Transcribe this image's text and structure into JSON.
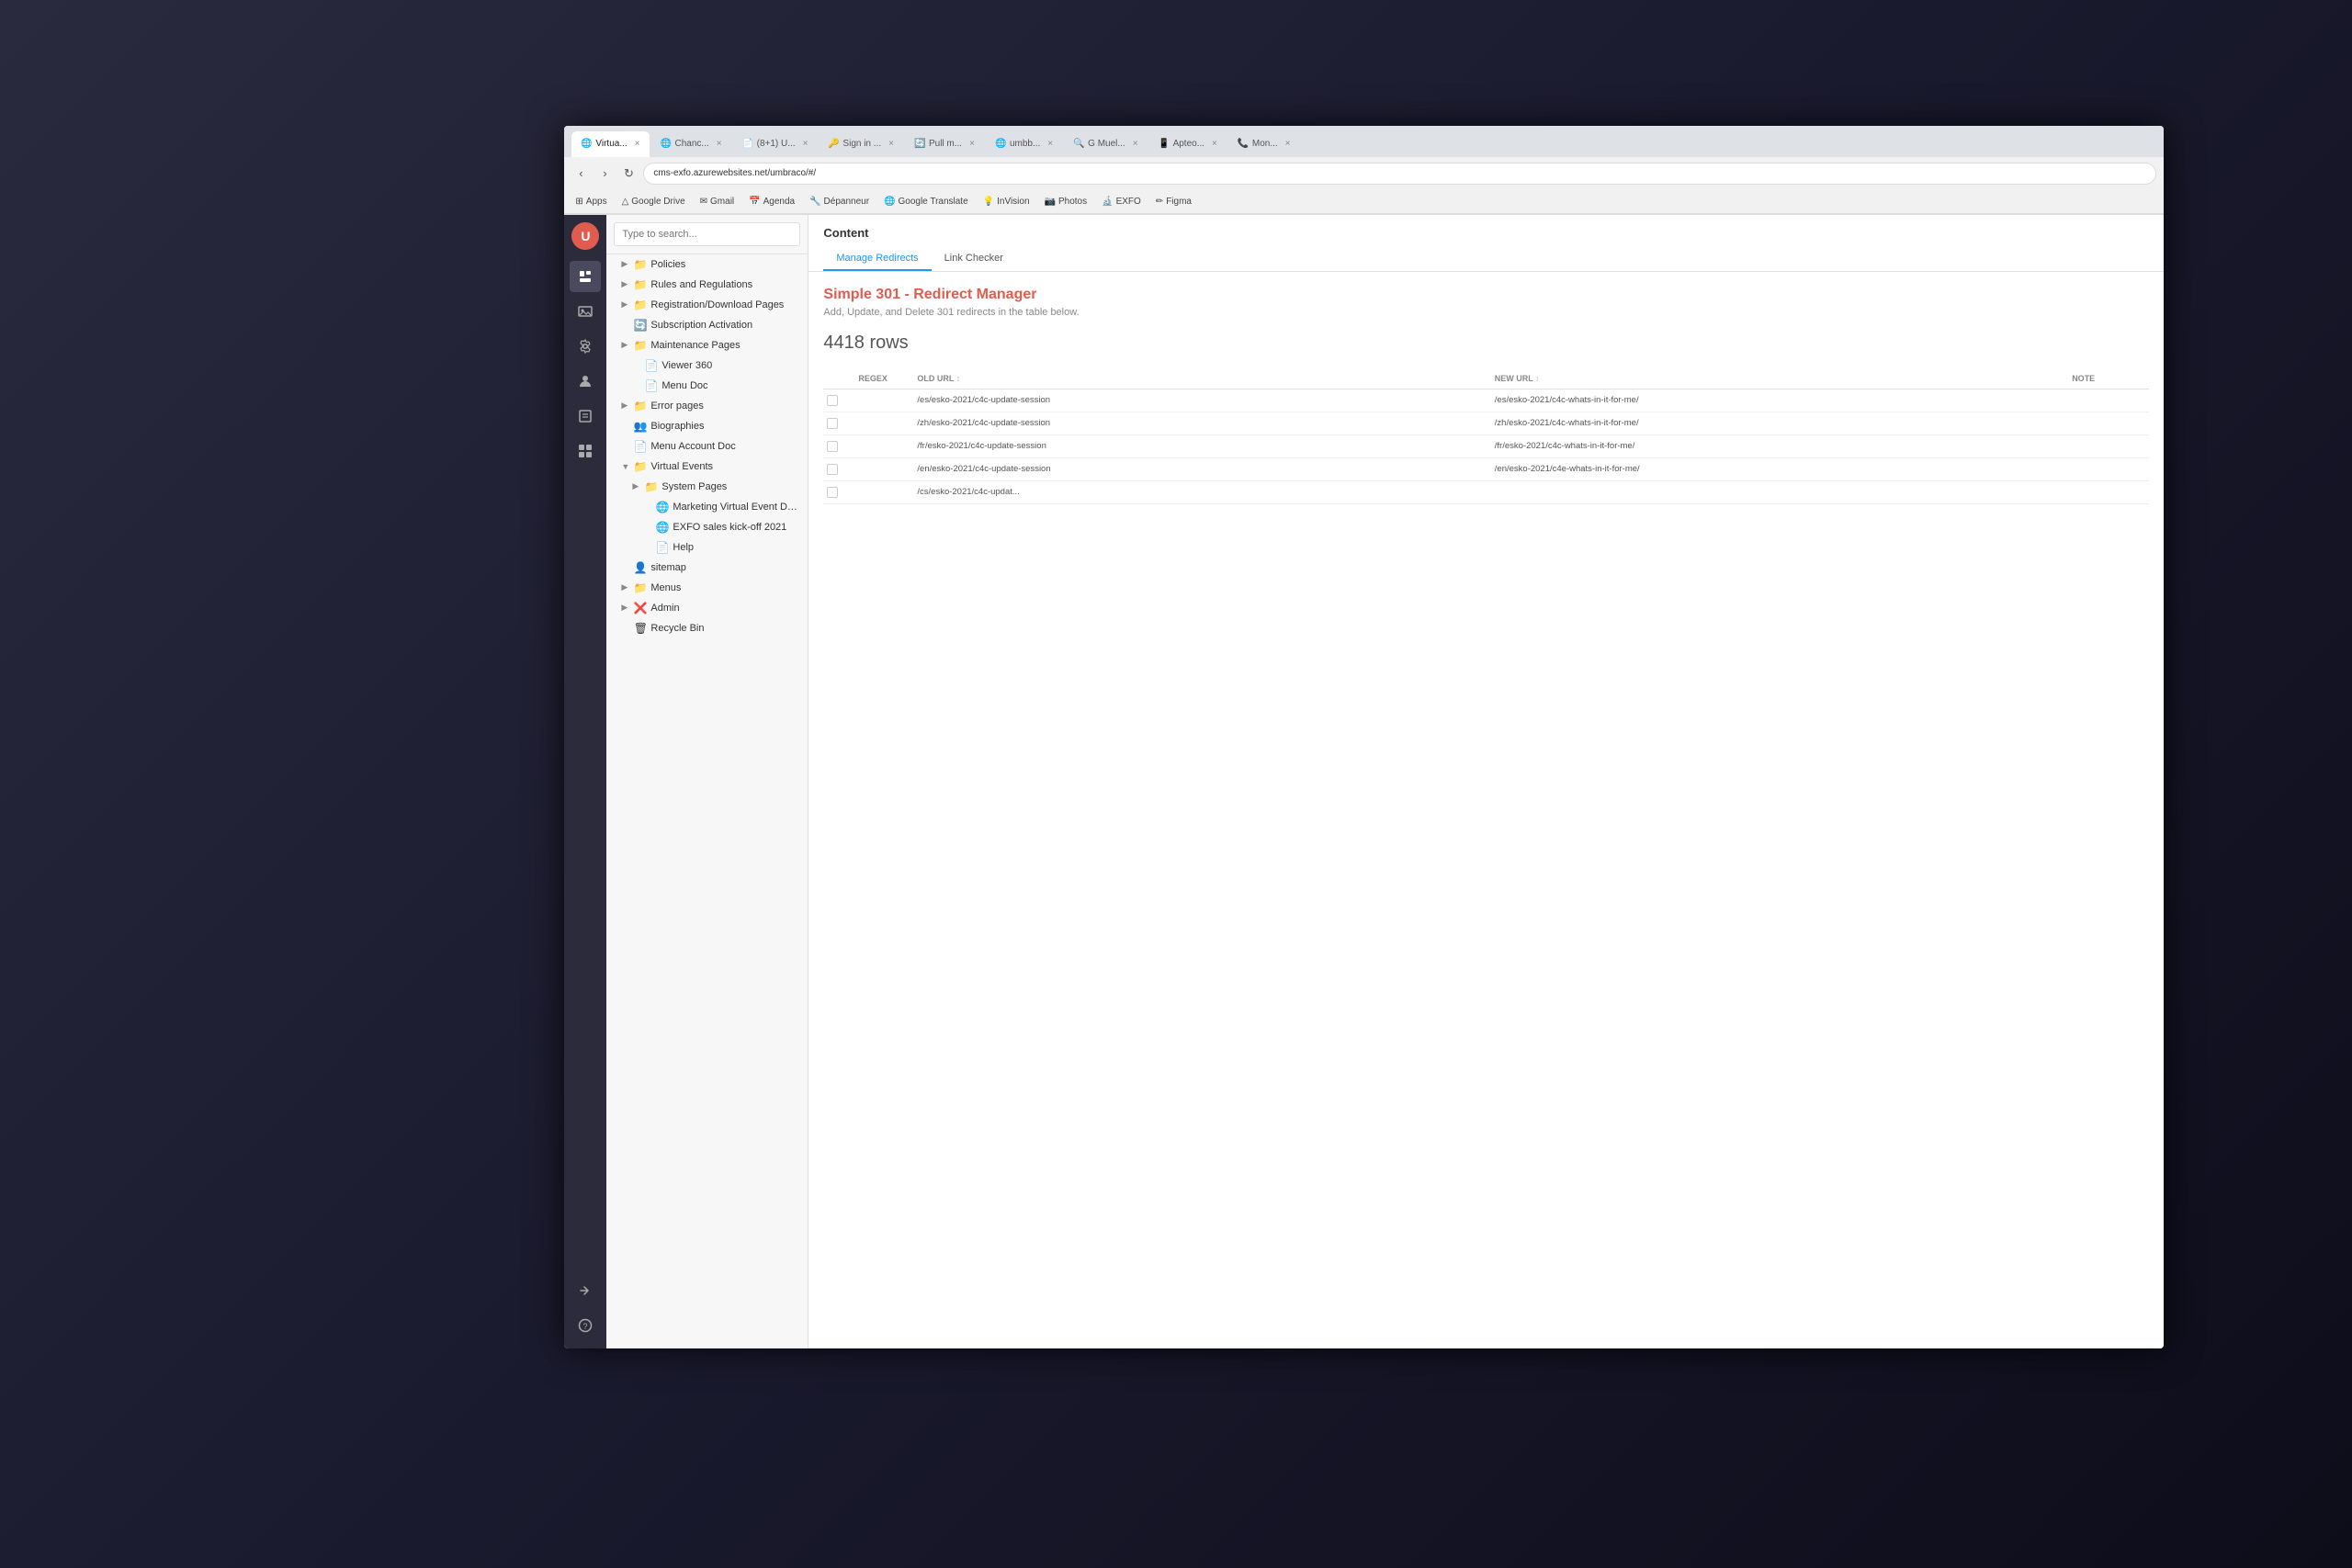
{
  "browser": {
    "address": "cms-exfo.azurewebsites.net/umbraco/#/",
    "tabs": [
      {
        "label": "Chanc...",
        "active": false,
        "favicon": "🌐"
      },
      {
        "label": "(8+1) U...",
        "active": false,
        "favicon": "📄"
      },
      {
        "label": "Sign in ...",
        "active": false,
        "favicon": "🔑"
      },
      {
        "label": "Pull m...",
        "active": false,
        "favicon": "🔄"
      },
      {
        "label": "Virtua...",
        "active": true,
        "favicon": "🌐"
      },
      {
        "label": "umbb...",
        "active": false,
        "favicon": "🌐"
      },
      {
        "label": "G Muel...",
        "active": false,
        "favicon": "🔍"
      },
      {
        "label": "Apteo...",
        "active": false,
        "favicon": "📱"
      },
      {
        "label": "Mon...",
        "active": false,
        "favicon": "📞"
      }
    ],
    "bookmarks": [
      {
        "label": "Apps",
        "favicon": "⊞"
      },
      {
        "label": "Google Drive",
        "favicon": "△"
      },
      {
        "label": "Gmail",
        "favicon": "✉"
      },
      {
        "label": "Agenda",
        "favicon": "📅"
      },
      {
        "label": "Dépanneur",
        "favicon": "🔧"
      },
      {
        "label": "Google Translate",
        "favicon": "🌐"
      },
      {
        "label": "InVision",
        "favicon": "💡"
      },
      {
        "label": "Photos",
        "favicon": "📷"
      },
      {
        "label": "EXFO",
        "favicon": "🔬"
      },
      {
        "label": "Figma",
        "favicon": "✏"
      }
    ]
  },
  "sidebar": {
    "icons": [
      {
        "name": "content",
        "icon": "📄"
      },
      {
        "name": "media",
        "icon": "🖼"
      },
      {
        "name": "settings",
        "icon": "⚙"
      },
      {
        "name": "users",
        "icon": "👤"
      },
      {
        "name": "forms",
        "icon": "📋"
      },
      {
        "name": "dashboard",
        "icon": "▦"
      },
      {
        "name": "redirect",
        "icon": "➤"
      },
      {
        "name": "help",
        "icon": "?"
      }
    ]
  },
  "search": {
    "placeholder": "Type to search..."
  },
  "tree": {
    "items": [
      {
        "label": "Policies",
        "level": 1,
        "icon": "📁",
        "hasChildren": true,
        "expanded": false
      },
      {
        "label": "Rules and Regulations",
        "level": 1,
        "icon": "📁",
        "hasChildren": true,
        "expanded": false
      },
      {
        "label": "Registration/Download Pages",
        "level": 1,
        "icon": "📁",
        "hasChildren": true,
        "expanded": false
      },
      {
        "label": "Subscription Activation",
        "level": 1,
        "icon": "🔄",
        "hasChildren": false
      },
      {
        "label": "Maintenance Pages",
        "level": 1,
        "icon": "📁",
        "hasChildren": true,
        "expanded": false
      },
      {
        "label": "Viewer 360",
        "level": 2,
        "icon": "📄",
        "hasChildren": false
      },
      {
        "label": "Menu Doc",
        "level": 2,
        "icon": "📄",
        "hasChildren": false
      },
      {
        "label": "Error pages",
        "level": 1,
        "icon": "📁",
        "hasChildren": true,
        "expanded": false
      },
      {
        "label": "Biographies",
        "level": 1,
        "icon": "👥",
        "hasChildren": false
      },
      {
        "label": "Menu Account Doc",
        "level": 1,
        "icon": "📄",
        "hasChildren": false
      },
      {
        "label": "Virtual Events",
        "level": 1,
        "icon": "📁",
        "hasChildren": true,
        "expanded": true
      },
      {
        "label": "System Pages",
        "level": 2,
        "icon": "📁",
        "hasChildren": true,
        "expanded": false
      },
      {
        "label": "Marketing Virtual Event Demo",
        "level": 3,
        "icon": "🌐",
        "hasChildren": false
      },
      {
        "label": "EXFO sales kick-off 2021",
        "level": 3,
        "icon": "🌐",
        "hasChildren": false
      },
      {
        "label": "Help",
        "level": 3,
        "icon": "📄",
        "hasChildren": false,
        "showDots": true
      },
      {
        "label": "sitemap",
        "level": 1,
        "icon": "👤",
        "hasChildren": false
      },
      {
        "label": "Menus",
        "level": 1,
        "icon": "📁",
        "hasChildren": true,
        "expanded": false
      },
      {
        "label": "Admin",
        "level": 1,
        "icon": "❌",
        "hasChildren": true,
        "expanded": false
      },
      {
        "label": "Recycle Bin",
        "level": 1,
        "icon": "🗑",
        "hasChildren": false
      }
    ]
  },
  "content": {
    "title": "Content",
    "tabs": [
      {
        "label": "Manage Redirects",
        "active": true
      },
      {
        "label": "Link Checker",
        "active": false
      }
    ],
    "redirect_manager": {
      "title": "Simple 301 - Redirect Manager",
      "subtitle": "Add, Update, and Delete 301 redirects in the table below.",
      "rows_count": "4418 rows",
      "table_headers": {
        "regex": "REGEX",
        "old_url": "OLD URL",
        "new_url": "NEW URL",
        "notes": "NOTE"
      },
      "rows": [
        {
          "old_url": "/es/esko-2021/c4c-update-session",
          "new_url": "/es/esko-2021/c4c-whats-in-it-for-me/"
        },
        {
          "old_url": "/zh/esko-2021/c4c-update-session",
          "new_url": "/zh/esko-2021/c4c-whats-in-it-for-me/"
        },
        {
          "old_url": "/fr/esko-2021/c4c-update-session",
          "new_url": "/fr/esko-2021/c4c-whats-in-it-for-me/"
        },
        {
          "old_url": "/en/esko-2021/c4c-update-session",
          "new_url": "/en/esko-2021/c4e-whats-in-it-for-me/"
        },
        {
          "old_url": "/cs/esko-2021/c4c-updat...",
          "new_url": ""
        }
      ]
    }
  }
}
